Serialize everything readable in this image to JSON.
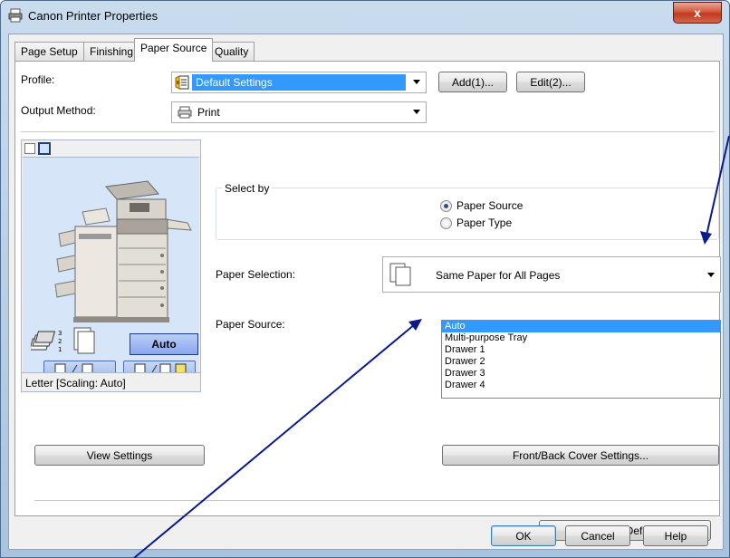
{
  "window": {
    "title": "Canon Printer Properties",
    "close_glyph": "x",
    "icon": "printer-icon"
  },
  "tabs": [
    {
      "label": "Page Setup",
      "active": false
    },
    {
      "label": "Finishing",
      "active": false
    },
    {
      "label": "Paper Source",
      "active": true
    },
    {
      "label": "Quality",
      "active": false
    }
  ],
  "profile": {
    "label": "Profile:",
    "value": "Default Settings",
    "add_label": "Add(1)...",
    "edit_label": "Edit(2)..."
  },
  "output_method": {
    "label": "Output Method:",
    "value": "Print"
  },
  "preview": {
    "status": "Letter [Scaling: Auto]",
    "auto_label": "Auto",
    "view_settings_label": "View Settings"
  },
  "select_by": {
    "legend": "Select by",
    "options": [
      {
        "label": "Paper Source",
        "checked": true
      },
      {
        "label": "Paper Type",
        "checked": false
      }
    ]
  },
  "paper_selection": {
    "label": "Paper Selection:",
    "value": "Same Paper for All Pages"
  },
  "paper_source": {
    "label": "Paper Source:",
    "items": [
      "Auto",
      "Multi-purpose Tray",
      "Drawer 1",
      "Drawer 2",
      "Drawer 3",
      "Drawer 4"
    ],
    "selected_index": 0
  },
  "buttons": {
    "front_back_cover": "Front/Back Cover Settings...",
    "restore_defaults": "Restore Defaults",
    "ok": "OK",
    "cancel": "Cancel",
    "help": "Help"
  },
  "colors": {
    "selection": "#3399ff",
    "profile_highlight": "#3399ff",
    "preview_background": "#d6e6f8",
    "annotation_arrow": "#0a1a8a"
  }
}
